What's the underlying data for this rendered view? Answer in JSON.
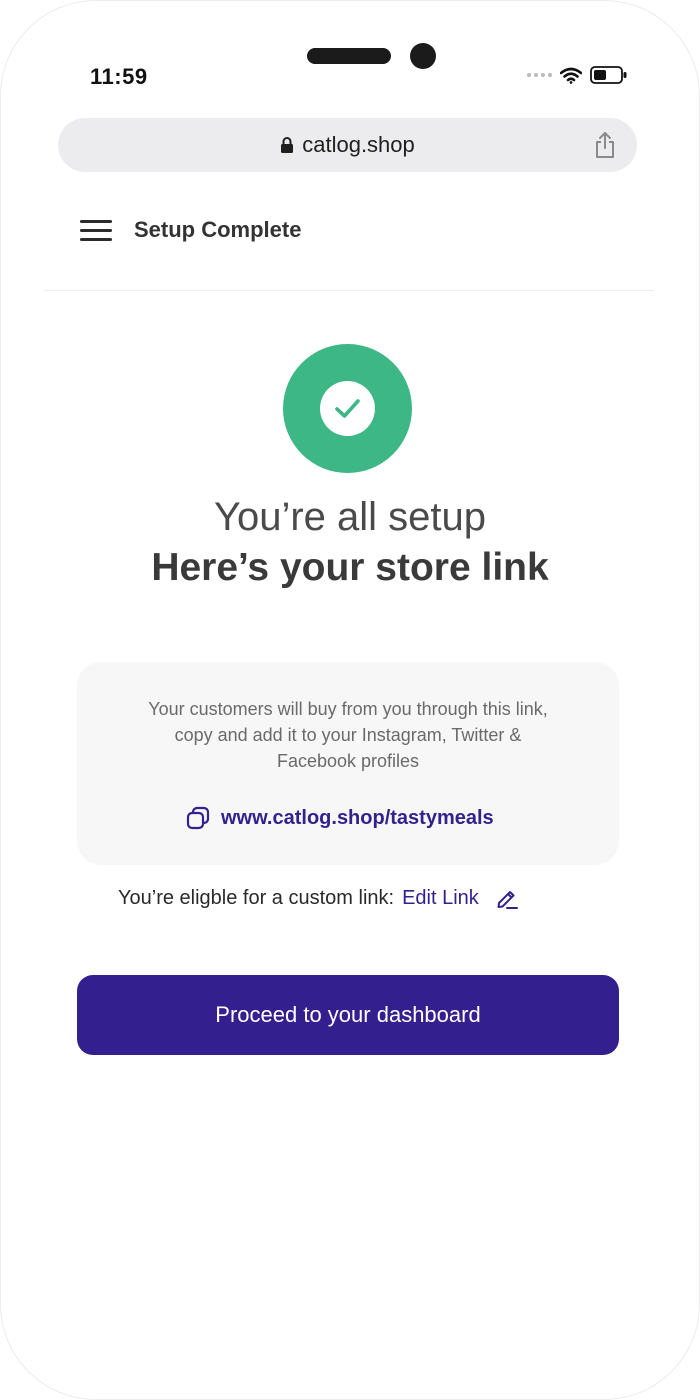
{
  "status_bar": {
    "time": "11:59"
  },
  "browser": {
    "url": "catlog.shop"
  },
  "nav": {
    "title": "Setup Complete"
  },
  "success": {
    "heading_light": "You’re all setup",
    "heading_bold": "Here’s your store link"
  },
  "link_card": {
    "description_lines": [
      "Your customers will buy from you through this link,",
      "copy and add it to your Instagram, Twitter &",
      "Facebook profiles"
    ],
    "store_link": "www.catlog.shop/tastymeals"
  },
  "custom_link": {
    "text": "You’re eligble for a custom link:",
    "edit_label": "Edit Link"
  },
  "cta": {
    "label": "Proceed to your dashboard"
  },
  "colors": {
    "accent": "#33208E",
    "success": "#3DB786",
    "card_bg": "#F7F7F7",
    "url_bar_bg": "#ECECEE"
  },
  "icons": [
    "lock-icon",
    "share-icon",
    "menu-icon",
    "check-icon",
    "copy-icon",
    "edit-pencil-icon",
    "wifi-icon",
    "battery-icon",
    "signal-icon"
  ]
}
